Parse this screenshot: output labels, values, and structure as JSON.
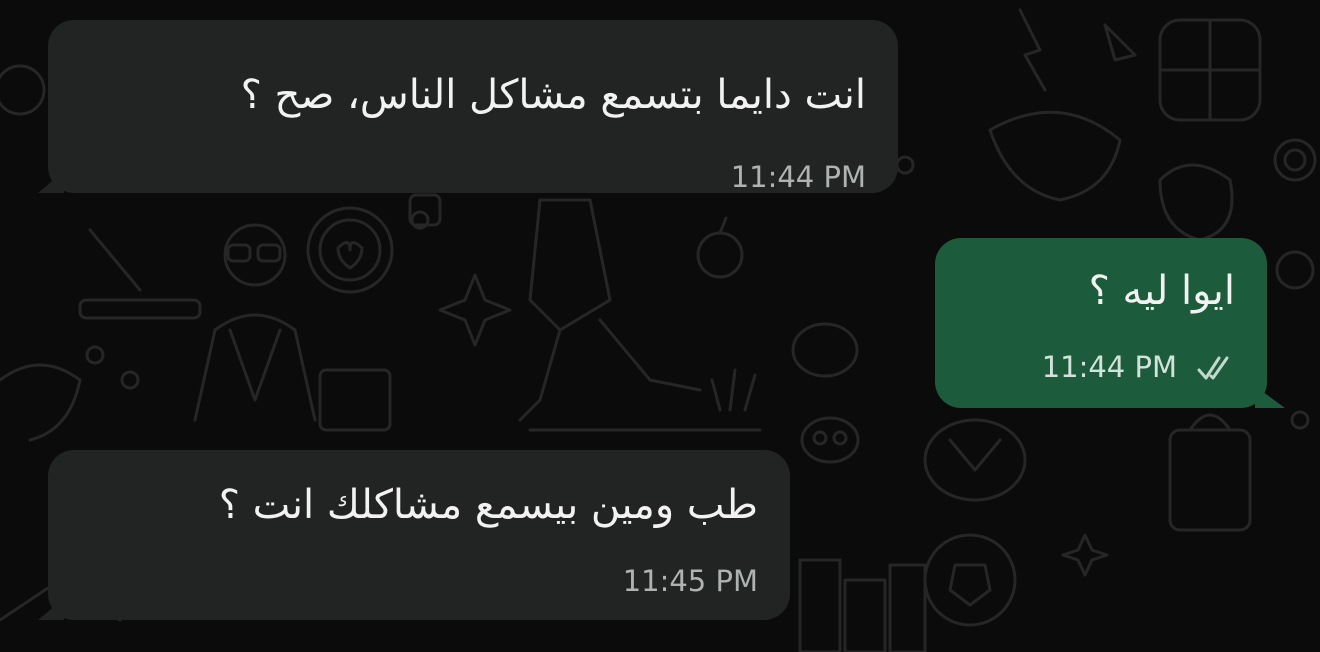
{
  "messages": [
    {
      "direction": "incoming",
      "text": "انت دايما بتسمع مشاكل الناس، صح ؟",
      "time": "11:44 PM"
    },
    {
      "direction": "outgoing",
      "text": "ايوا ليه ؟",
      "time": "11:44 PM",
      "status_icon": "double-check-icon"
    },
    {
      "direction": "incoming",
      "text": "طب ومين بيسمع مشاكلك انت ؟",
      "time": "11:45 PM"
    }
  ],
  "colors": {
    "background": "#0b0b0b",
    "incoming_bubble": "#222323",
    "outgoing_bubble": "#1c5b3b",
    "text": "#f2f2f2",
    "timestamp": "#aeb3b2"
  }
}
